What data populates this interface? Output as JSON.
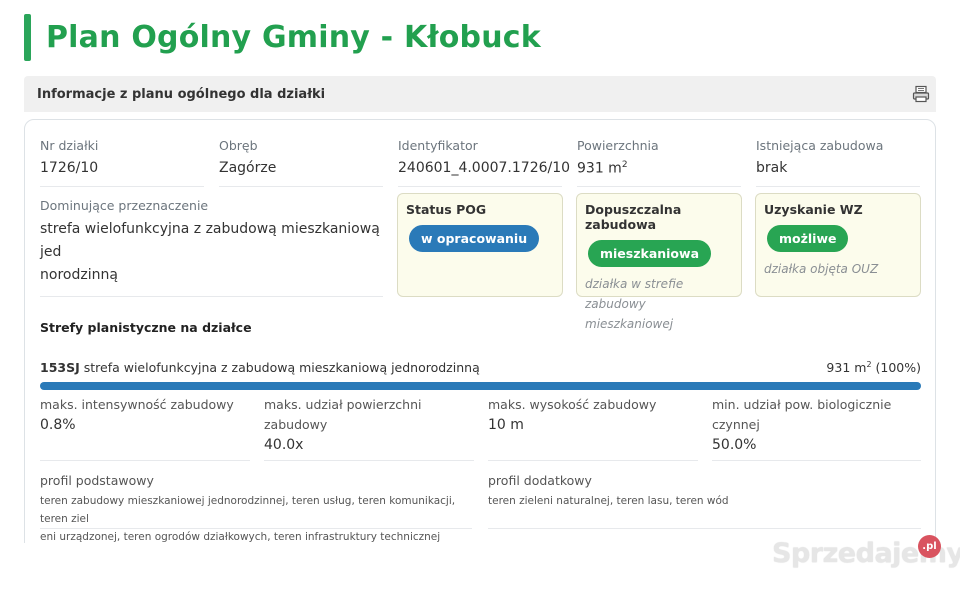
{
  "page_title": "Plan Ogólny Gminy - Kłobuck",
  "section_header": {
    "title": "Informacje z planu ogólnego dla działki",
    "print_icon": "printer-icon"
  },
  "parcel": {
    "nr_label": "Nr działki",
    "nr_value": "1726/10",
    "obreb_label": "Obręb",
    "obreb_value": "Zagórze",
    "id_label": "Identyfikator",
    "id_value": "240601_4.0007.1726/10",
    "area_label": "Powierzchnia",
    "area_value": "931 m",
    "area_unit_sup": "2",
    "zabudowa_label": "Istniejąca zabudowa",
    "zabudowa_value": "brak",
    "dominant_label": "Dominujące przeznaczenie",
    "dominant_value_line1": "strefa wielofunkcyjna z zabudową mieszkaniową jed",
    "dominant_value_line2": "norodzinną"
  },
  "boxes": {
    "status": {
      "title": "Status POG",
      "badge": "w opracowaniu",
      "badge_color": "#2a7ab8"
    },
    "dopuszczalna": {
      "title": "Dopuszczalna zabudowa",
      "badge": "mieszkaniowa",
      "badge_color": "#28a553",
      "note_line1": "działka w strefie",
      "note_line2": "zabudowy mieszkaniowej"
    },
    "wz": {
      "title": "Uzyskanie WZ",
      "badge": "możliwe",
      "badge_color": "#28a553",
      "note": "działka objęta OUZ"
    }
  },
  "zones": {
    "title": "Strefy planistyczne na działce",
    "items": [
      {
        "code": "153SJ",
        "name": "strefa wielofunkcyjna z zabudową mieszkaniową jednorodzinną",
        "area_prefix": "931 m",
        "area_sup": "2",
        "area_suffix": " (100%)",
        "share": 1.0,
        "bar_color": "#2a7ab8"
      }
    ]
  },
  "params": {
    "intensywnosc_label": "maks. intensywność zabudowy",
    "intensywnosc_value": "0.8%",
    "udzial_label": "maks. udział powierzchni zabudowy",
    "udzial_value": "40.0x",
    "wysokosc_label": "maks. wysokość zabudowy",
    "wysokosc_value": "10 m",
    "bio_label_line1": "min. udział pow. biologicznie",
    "bio_label_line2": "czynnej",
    "bio_value": "50.0%"
  },
  "profiles": {
    "podstawowy_label": "profil podstawowy",
    "podstawowy_line1": "teren zabudowy mieszkaniowej jednorodzinnej, teren usług, teren komunikacji, teren ziel",
    "podstawowy_line2": "eni urządzonej, teren ogrodów działkowych, teren infrastruktury technicznej",
    "dodatkowy_label": "profil dodatkowy",
    "dodatkowy_value": "teren zieleni naturalnej, teren lasu, teren wód"
  },
  "watermark": {
    "text": "Sprzedajemy",
    "badge": ".pl"
  },
  "colors": {
    "title_green": "#22a04f",
    "accent_bar": "#2aa55a",
    "box_bg": "#fcfcec"
  }
}
